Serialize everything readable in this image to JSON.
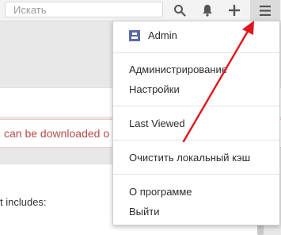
{
  "search": {
    "placeholder": "Искать"
  },
  "toolbar": {
    "search_icon": "search-icon",
    "bell_icon": "bell-icon",
    "plus_icon": "plus-icon",
    "menu_icon": "hamburger-icon"
  },
  "background": {
    "notice_text": "can be downloaded o",
    "content_text": "t includes:"
  },
  "menu": {
    "user_name": "Admin",
    "items_group1": [
      "Администрирование",
      "Настройки"
    ],
    "last_viewed": "Last Viewed",
    "clear_cache": "Очистить локальный кэш",
    "about": "О программе",
    "logout": "Выйти"
  },
  "colors": {
    "annotation_arrow": "#e0161c",
    "notice_text": "#b54a4a",
    "user_icon": "#5b6aa5"
  }
}
